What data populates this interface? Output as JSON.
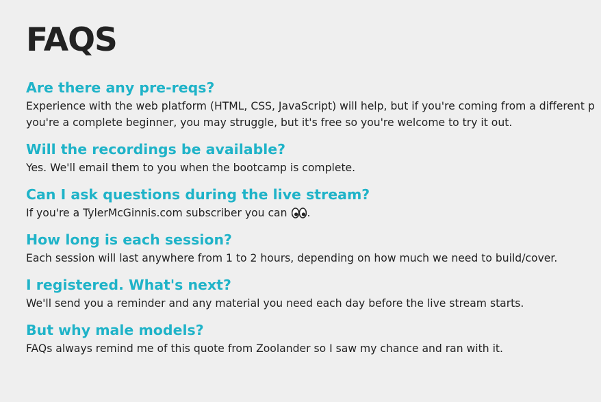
{
  "page": {
    "title": "FAQS"
  },
  "faqs": [
    {
      "question": "Are there any pre-reqs?",
      "answer_lines": [
        "Experience with the web platform (HTML, CSS, JavaScript) will help, but if you're coming from a different p",
        "you're a complete beginner, you may struggle, but it's free so you're welcome to try it out."
      ]
    },
    {
      "question": "Will the recordings be available?",
      "answer_lines": [
        "Yes. We'll email them to you when the bootcamp is complete."
      ]
    },
    {
      "question": "Can I ask questions during the live stream?",
      "answer_prefix": "If you're a TylerMcGinnis.com subscriber you can ",
      "answer_icon": "eyes-icon",
      "answer_suffix": "."
    },
    {
      "question": "How long is each session?",
      "answer_lines": [
        "Each session will last anywhere from 1 to 2 hours, depending on how much we need to build/cover."
      ]
    },
    {
      "question": "I registered. What's next?",
      "answer_lines": [
        "We'll send you a reminder and any material you need each day before the live stream starts."
      ]
    },
    {
      "question": "But why male models?",
      "answer_lines": [
        "FAQs always remind me of this quote from Zoolander so I saw my chance and ran with it."
      ]
    }
  ],
  "colors": {
    "background": "#efefef",
    "question": "#1fb3c8",
    "text": "#222222"
  }
}
